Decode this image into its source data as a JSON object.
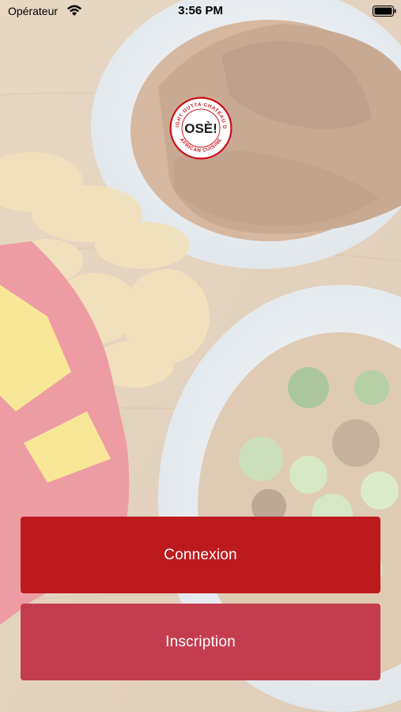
{
  "status_bar": {
    "carrier": "Opérateur",
    "time": "3:56 PM",
    "wifi_icon": "wifi-icon",
    "battery_icon": "battery-icon"
  },
  "logo": {
    "brand": "OSÈ!",
    "ring_text": "STRAIGHT OUTTA CHATEAU D'EAU · AFRICAN CUISINE ·",
    "icon": "brand-logo-seal"
  },
  "background": {
    "icon": "food-photo-background"
  },
  "buttons": {
    "login_label": "Connexion",
    "signup_label": "Inscription"
  },
  "colors": {
    "login_bg": "#bd1a1e",
    "signup_bg": "#c43d4f",
    "brand_red": "#c8161d"
  }
}
